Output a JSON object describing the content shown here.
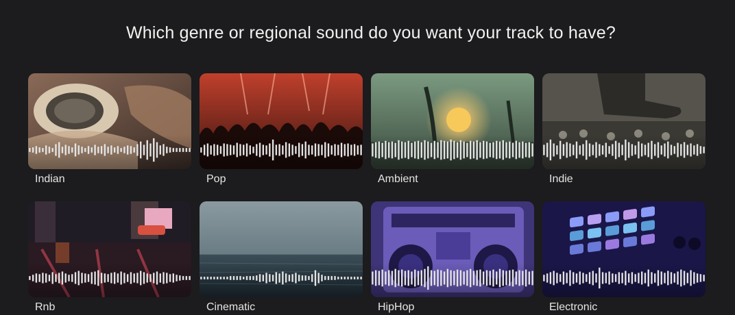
{
  "question": "Which genre or regional sound do you want your track to have?",
  "genres": [
    {
      "label": "Indian",
      "wave": [
        3,
        4,
        6,
        4,
        3,
        7,
        5,
        3,
        9,
        12,
        5,
        8,
        6,
        4,
        10,
        7,
        5,
        3,
        6,
        4,
        8,
        5,
        6,
        9,
        5,
        7,
        4,
        6,
        3,
        5,
        7,
        6,
        4,
        9,
        13,
        8,
        15,
        10,
        18,
        12,
        7,
        9,
        5,
        4,
        3,
        3,
        3,
        3,
        3,
        3
      ],
      "colors": {
        "bg": "#6b5246",
        "accent": "#b8a48f",
        "dark": "#2b2420"
      }
    },
    {
      "label": "Pop",
      "wave": [
        4,
        8,
        10,
        7,
        9,
        8,
        6,
        10,
        9,
        8,
        7,
        11,
        9,
        8,
        10,
        7,
        5,
        9,
        11,
        8,
        7,
        10,
        16,
        8,
        9,
        7,
        12,
        10,
        8,
        6,
        11,
        9,
        13,
        8,
        7,
        10,
        9,
        8,
        12,
        10,
        7,
        9,
        8,
        11,
        9,
        10,
        8,
        9,
        7,
        8
      ],
      "colors": {
        "bg": "#8a2a1c",
        "accent": "#e86a4a",
        "dark": "#1f0e0c"
      }
    },
    {
      "label": "Ambient",
      "wave": [
        10,
        12,
        13,
        11,
        14,
        12,
        13,
        11,
        15,
        13,
        12,
        14,
        11,
        13,
        14,
        12,
        15,
        13,
        11,
        14,
        12,
        15,
        14,
        13,
        16,
        14,
        12,
        15,
        13,
        11,
        14,
        13,
        15,
        12,
        14,
        13,
        11,
        12,
        14,
        13,
        15,
        12,
        13,
        11,
        14,
        12,
        13,
        11,
        12,
        10
      ],
      "colors": {
        "bg": "#5f7a62",
        "accent": "#f0c060",
        "dark": "#2f3c33"
      }
    },
    {
      "label": "Indie",
      "wave": [
        8,
        11,
        16,
        10,
        7,
        14,
        9,
        12,
        10,
        8,
        13,
        7,
        9,
        15,
        10,
        8,
        12,
        9,
        7,
        11,
        6,
        9,
        14,
        11,
        8,
        16,
        12,
        9,
        7,
        13,
        10,
        8,
        11,
        14,
        9,
        12,
        7,
        10,
        13,
        8,
        6,
        11,
        9,
        12,
        8,
        10,
        7,
        9,
        6,
        5
      ],
      "colors": {
        "bg": "#5c5a52",
        "accent": "#a09d92",
        "dark": "#2a2925"
      }
    },
    {
      "label": "Rnb",
      "wave": [
        3,
        5,
        7,
        6,
        8,
        7,
        5,
        9,
        6,
        8,
        10,
        7,
        5,
        6,
        9,
        11,
        8,
        7,
        6,
        9,
        10,
        12,
        8,
        7,
        6,
        8,
        9,
        7,
        10,
        8,
        6,
        9,
        7,
        8,
        11,
        9,
        7,
        6,
        8,
        10,
        7,
        9,
        8,
        6,
        7,
        5,
        4,
        3,
        3,
        3
      ],
      "colors": {
        "bg": "#2b2530",
        "accent": "#d84a5a",
        "dark": "#131016"
      }
    },
    {
      "label": "Cinematic",
      "wave": [
        2,
        2,
        2,
        2,
        2,
        2,
        2,
        2,
        2,
        3,
        3,
        3,
        3,
        2,
        3,
        3,
        3,
        4,
        6,
        5,
        8,
        6,
        5,
        9,
        7,
        10,
        7,
        5,
        6,
        8,
        5,
        4,
        4,
        3,
        6,
        12,
        8,
        5,
        3,
        3,
        3,
        3,
        2,
        2,
        2,
        2,
        2,
        2,
        2,
        2
      ],
      "colors": {
        "bg": "#4f6066",
        "accent": "#7f9096",
        "dark": "#1f2a30"
      }
    },
    {
      "label": "HipHop",
      "wave": [
        10,
        12,
        11,
        13,
        10,
        12,
        11,
        14,
        12,
        13,
        11,
        12,
        10,
        13,
        11,
        12,
        14,
        18,
        12,
        11,
        13,
        12,
        10,
        14,
        12,
        11,
        13,
        12,
        10,
        12,
        14,
        11,
        12,
        13,
        10,
        12,
        11,
        13,
        10,
        14,
        12,
        11,
        12,
        13,
        10,
        12,
        11,
        13,
        10,
        11
      ],
      "colors": {
        "bg": "#4b3f8e",
        "accent": "#b8a8f0",
        "dark": "#1d173a"
      }
    },
    {
      "label": "Electronic",
      "wave": [
        5,
        7,
        9,
        11,
        8,
        6,
        10,
        8,
        12,
        9,
        7,
        10,
        8,
        6,
        9,
        11,
        7,
        16,
        9,
        8,
        10,
        7,
        6,
        9,
        8,
        11,
        7,
        9,
        6,
        8,
        10,
        8,
        13,
        9,
        7,
        12,
        10,
        8,
        11,
        9,
        7,
        10,
        13,
        11,
        8,
        12,
        9,
        7,
        6,
        5
      ],
      "colors": {
        "bg": "#27226a",
        "accent": "#7a8ff0",
        "dark": "#0f0d2e"
      }
    }
  ]
}
